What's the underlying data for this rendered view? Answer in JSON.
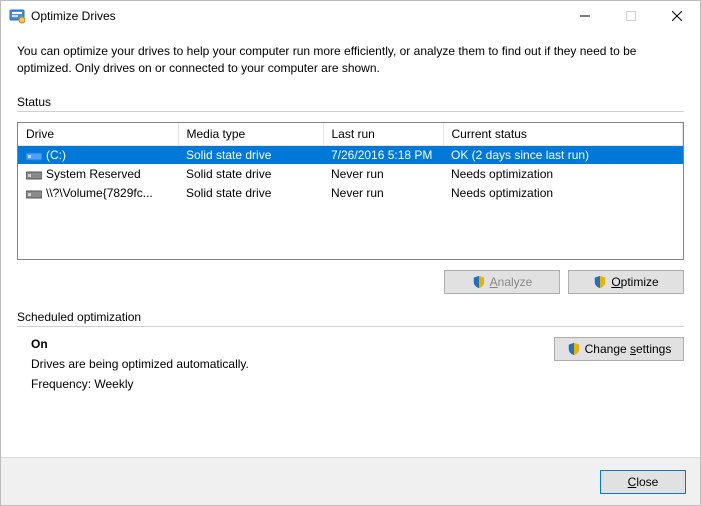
{
  "window": {
    "title": "Optimize Drives"
  },
  "description": "You can optimize your drives to help your computer run more efficiently, or analyze them to find out if they need to be optimized. Only drives on or connected to your computer are shown.",
  "status_label": "Status",
  "headers": {
    "drive": "Drive",
    "media": "Media type",
    "lastrun": "Last run",
    "status": "Current status"
  },
  "rows": [
    {
      "drive": "(C:)",
      "media": "Solid state drive",
      "lastrun": "7/26/2016 5:18 PM",
      "status": "OK (2 days since last run)",
      "selected": true,
      "icon": "ssd-blue"
    },
    {
      "drive": "System Reserved",
      "media": "Solid state drive",
      "lastrun": "Never run",
      "status": "Needs optimization",
      "selected": false,
      "icon": "ssd"
    },
    {
      "drive": "\\\\?\\Volume{7829fc...",
      "media": "Solid state drive",
      "lastrun": "Never run",
      "status": "Needs optimization",
      "selected": false,
      "icon": "ssd"
    }
  ],
  "buttons": {
    "analyze_prefix": "",
    "analyze_u": "A",
    "analyze_suffix": "nalyze",
    "optimize_prefix": "",
    "optimize_u": "O",
    "optimize_suffix": "ptimize",
    "change_prefix": "Change ",
    "change_u": "s",
    "change_suffix": "ettings",
    "close_prefix": "",
    "close_u": "C",
    "close_suffix": "lose"
  },
  "scheduled": {
    "label": "Scheduled optimization",
    "on": "On",
    "line1": "Drives are being optimized automatically.",
    "line2": "Frequency: Weekly"
  }
}
